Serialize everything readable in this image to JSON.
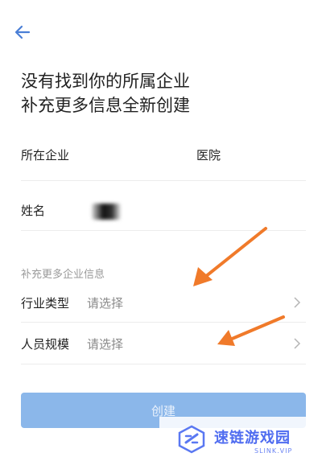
{
  "header": {
    "back_icon": "arrow-left-icon"
  },
  "title": {
    "line1": "没有找到你的所属企业",
    "line2": "补充更多信息全新创建"
  },
  "form": {
    "company": {
      "label": "所在企业",
      "value": "医院"
    },
    "name": {
      "label": "姓名"
    },
    "section_title": "补充更多企业信息",
    "industry": {
      "label": "行业类型",
      "placeholder": "请选择"
    },
    "staff_size": {
      "label": "人员规模",
      "placeholder": "请选择"
    }
  },
  "create_button": {
    "label": "创建"
  },
  "watermark": {
    "brand": "速链游戏园",
    "url": "SLINK.VIP"
  },
  "colors": {
    "accent": "#4a7fd6",
    "button": "#8bb7ea",
    "arrow": "#f07a2a",
    "watermark": "#4f6cf0"
  }
}
